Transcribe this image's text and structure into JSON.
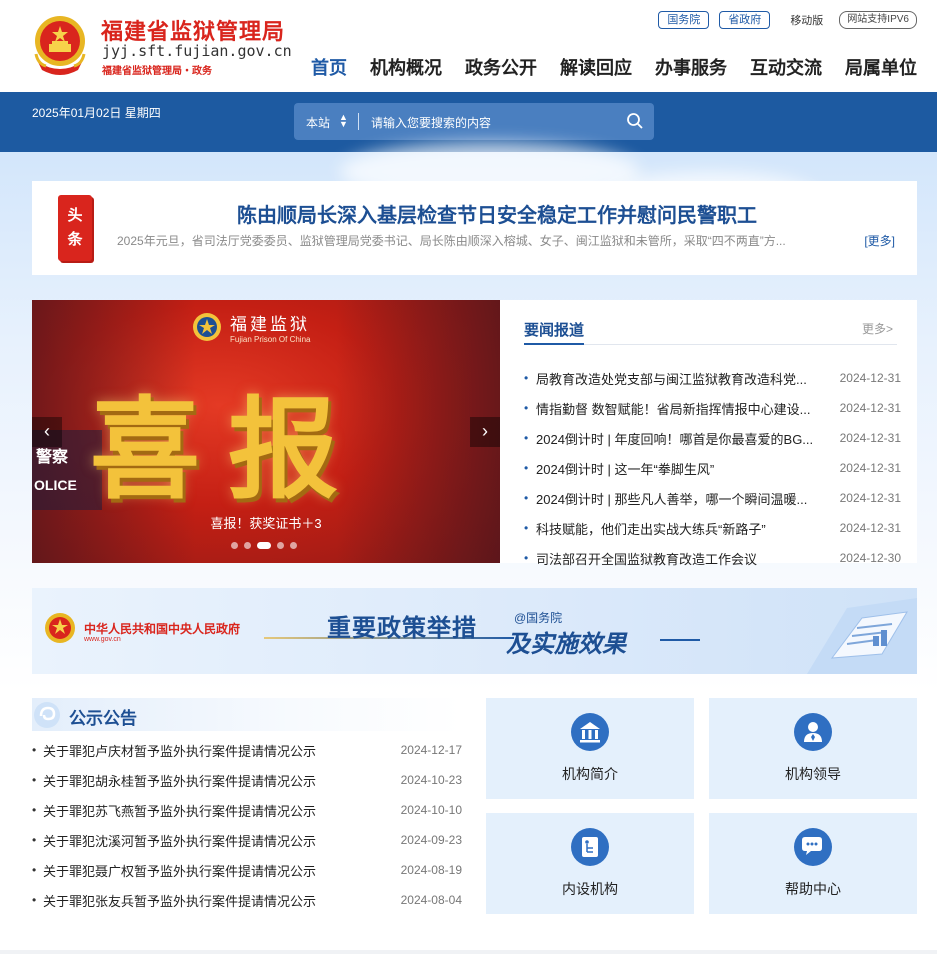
{
  "header": {
    "site_title": "福建省监狱管理局",
    "site_domain": "jyj.sft.fujian.gov.cn",
    "site_sub": "福建省监狱管理局・政务",
    "links": [
      "国务院",
      "省政府"
    ],
    "mobile": "移动版",
    "ipv6": "网站支持IPV6",
    "nav": [
      "首页",
      "机构概况",
      "政务公开",
      "解读回应",
      "办事服务",
      "互动交流",
      "局属单位"
    ]
  },
  "band": {
    "date": "2025年01月02日 星期四",
    "search_scope": "本站",
    "search_placeholder": "请输入您要搜索的内容"
  },
  "headline": {
    "tag": [
      "头",
      "条"
    ],
    "title": "陈由顺局长深入基层检查节日安全稳定工作并慰问民警职工",
    "desc": "2025年元旦，省司法厅党委委员、监狱管理局党委书记、局长陈由顺深入榕城、女子、闽江监狱和未管所，采取“四不两直”方...",
    "more": "[更多]"
  },
  "carousel": {
    "brand": "福建监狱",
    "brand_sub": "Fujian Prison Of China",
    "big_text": "喜报",
    "caption": "喜报！获奖证书＋3",
    "slide_count": 5,
    "active_slide": 3,
    "prev": "‹",
    "next": "›"
  },
  "news": {
    "title": "要闻报道",
    "more": "更多>",
    "items": [
      {
        "text": "局教育改造处党支部与闽江监狱教育改造科党...",
        "date": "2024-12-31"
      },
      {
        "text": "情指勤督 数智赋能！省局新指挥情报中心建设...",
        "date": "2024-12-31"
      },
      {
        "text": "2024倒计时 | 年度回响！哪首是你最喜爱的BG...",
        "date": "2024-12-31"
      },
      {
        "text": "2024倒计时 | 这一年“拳脚生风”",
        "date": "2024-12-31"
      },
      {
        "text": "2024倒计时 | 那些凡人善举，哪一个瞬间温暖...",
        "date": "2024-12-31"
      },
      {
        "text": "科技赋能，他们走出实战大练兵“新路子”",
        "date": "2024-12-31"
      },
      {
        "text": "司法部召开全国监狱教育改造工作会议",
        "date": "2024-12-30"
      }
    ]
  },
  "banner": {
    "gov_name": "中华人民共和国中央人民政府",
    "gov_url": "www.gov.cn",
    "line1": "重要政策举措",
    "at": "@国务院",
    "line2": "及实施效果"
  },
  "notices": {
    "title": "公示公告",
    "items": [
      {
        "text": "关于罪犯卢庆材暂予监外执行案件提请情况公示",
        "date": "2024-12-17"
      },
      {
        "text": "关于罪犯胡永桂暂予监外执行案件提请情况公示",
        "date": "2024-10-23"
      },
      {
        "text": "关于罪犯苏飞燕暂予监外执行案件提请情况公示",
        "date": "2024-10-10"
      },
      {
        "text": "关于罪犯沈溪河暂予监外执行案件提请情况公示",
        "date": "2024-09-23"
      },
      {
        "text": "关于罪犯聂广权暂予监外执行案件提请情况公示",
        "date": "2024-08-19"
      },
      {
        "text": "关于罪犯张友兵暂予监外执行案件提请情况公示",
        "date": "2024-08-04"
      }
    ]
  },
  "tiles": [
    {
      "label": "机构简介",
      "icon": "building-icon"
    },
    {
      "label": "机构领导",
      "icon": "person-icon"
    },
    {
      "label": "内设机构",
      "icon": "org-chart-icon"
    },
    {
      "label": "帮助中心",
      "icon": "chat-bubble-icon"
    }
  ],
  "colors": {
    "brand_red": "#d9251d",
    "brand_blue": "#1d5aa1",
    "link_blue": "#1f5aa6",
    "tile_bg": "#e4f0fc"
  }
}
